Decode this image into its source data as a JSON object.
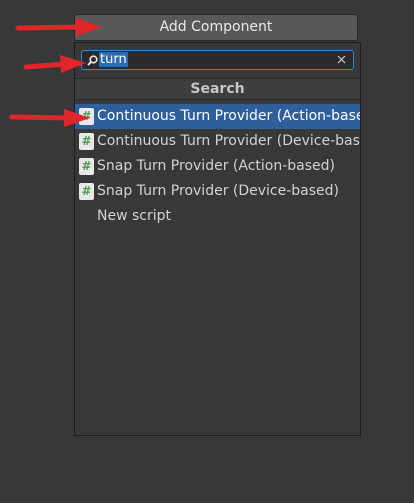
{
  "add_component": {
    "label": "Add Component"
  },
  "search": {
    "value": "turn"
  },
  "popup": {
    "header": "Search"
  },
  "results": [
    {
      "label": "Continuous Turn Provider (Action-based)",
      "icon": "csharp-script-icon",
      "selected": true
    },
    {
      "label": "Continuous Turn Provider (Device-based)",
      "icon": "csharp-script-icon",
      "selected": false
    },
    {
      "label": "Snap Turn Provider (Action-based)",
      "icon": "csharp-script-icon",
      "selected": false
    },
    {
      "label": "Snap Turn Provider (Device-based)",
      "icon": "csharp-script-icon",
      "selected": false
    },
    {
      "label": "New script",
      "icon": "",
      "selected": false
    }
  ],
  "colors": {
    "background": "#383838",
    "selection": "#2f5e9c",
    "focus": "#3d87c7",
    "annotation_arrow": "#e0262b"
  },
  "icons": {
    "hash": "#"
  }
}
